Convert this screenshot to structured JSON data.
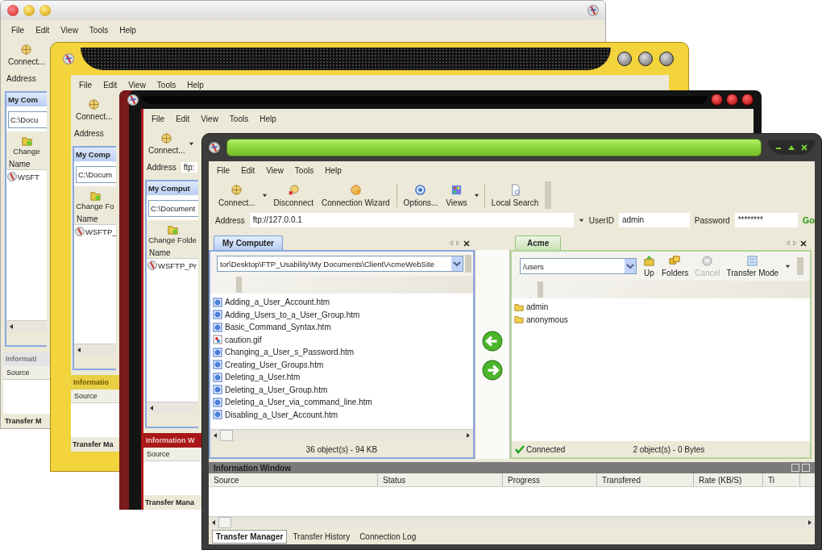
{
  "back_windows": [
    {
      "kind": "silver",
      "menu": [
        "File",
        "Edit",
        "View",
        "Tools",
        "Help"
      ],
      "toolbar_button": "Connect...",
      "toolbar_dropdown": false,
      "address_label": "Address",
      "pane_tab": "My Com",
      "path": "C:\\Docu",
      "change_folder": "Change",
      "column": "Name",
      "file": "WSFT",
      "info_title": "Informati",
      "info_column": "Source",
      "bottom_tab": "Transfer M"
    },
    {
      "kind": "yellow",
      "menu": [
        "File",
        "Edit",
        "View",
        "Tools",
        "Help"
      ],
      "toolbar_button": "Connect...",
      "toolbar_dropdown": false,
      "address_label": "Address",
      "pane_tab": "My Comp",
      "path": "C:\\Docum",
      "change_folder": "Change Fo",
      "column": "Name",
      "file": "WSFTP_",
      "info_title": "Informatio",
      "info_column": "Source",
      "bottom_tab": "Transfer Ma"
    },
    {
      "kind": "red",
      "menu": [
        "File",
        "Edit",
        "View",
        "Tools",
        "Help"
      ],
      "toolbar_button": "Connect...",
      "toolbar_dropdown": true,
      "address_label": "Address",
      "address_value": "ftp:",
      "pane_tab": "My Comput",
      "path": "C:\\Document",
      "change_folder": "Change Folde",
      "column": "Name",
      "file": "WSFTP_Pr",
      "info_title": "Information W",
      "info_column": "Source",
      "bottom_tab": "Transfer Mana"
    }
  ],
  "window": {
    "menu": [
      "File",
      "Edit",
      "View",
      "Tools",
      "Help"
    ],
    "toolbar": [
      {
        "label": "Connect...",
        "dropdown": true,
        "separator_after": false
      },
      {
        "label": "Disconnect",
        "dropdown": false,
        "separator_after": false
      },
      {
        "label": "Connection Wizard",
        "dropdown": false,
        "separator_after": true
      },
      {
        "label": "Options...",
        "dropdown": false,
        "separator_after": false
      },
      {
        "label": "Views",
        "dropdown": true,
        "separator_after": true
      },
      {
        "label": "Local Search",
        "dropdown": false,
        "separator_after": false
      }
    ],
    "address": {
      "label": "Address",
      "value": "ftp://127.0.0.1"
    },
    "user": {
      "label": "UserID",
      "value": "admin"
    },
    "password": {
      "label": "Password",
      "value": "********"
    },
    "go": "Go",
    "local_pane": {
      "tab": "My Computer",
      "path": "tor\\Desktop\\FTP_Usability\\My Documents\\Client\\AcmeWebSite",
      "files": [
        {
          "name": "Adding_a_User_Account.htm",
          "kind": "web"
        },
        {
          "name": "Adding_Users_to_a_User_Group.htm",
          "kind": "web"
        },
        {
          "name": "Basic_Command_Syntax.htm",
          "kind": "web"
        },
        {
          "name": "caution.gif",
          "kind": "image"
        },
        {
          "name": "Changing_a_User_s_Password.htm",
          "kind": "web"
        },
        {
          "name": "Creating_User_Groups.htm",
          "kind": "web"
        },
        {
          "name": "Deleting_a_User.htm",
          "kind": "web"
        },
        {
          "name": "Deleting_a_User_Group.htm",
          "kind": "web"
        },
        {
          "name": "Deleting_a_User_via_command_line.htm",
          "kind": "web"
        },
        {
          "name": "Disabling_a_User_Account.htm",
          "kind": "web"
        }
      ],
      "status": "36 object(s) - 94 KB"
    },
    "remote_pane": {
      "tab": "Acme",
      "path": "/users",
      "buttons": [
        {
          "label": "Up",
          "kind": "up",
          "disabled": false
        },
        {
          "label": "Folders",
          "kind": "folders",
          "disabled": false
        },
        {
          "label": "Cancel",
          "kind": "cancel",
          "disabled": true
        },
        {
          "label": "Transfer Mode",
          "kind": "mode",
          "disabled": false
        }
      ],
      "folders": [
        "admin",
        "anonymous"
      ],
      "connection": "Connected",
      "status": "2 object(s) - 0 Bytes"
    },
    "info": {
      "title": "Information Window",
      "columns": [
        "Source",
        "Status",
        "Progress",
        "Transfered",
        "Rate (KB/S)",
        "Ti"
      ],
      "tabs": [
        {
          "label": "Transfer Manager",
          "selected": true
        },
        {
          "label": "Transfer History",
          "selected": false
        },
        {
          "label": "Connection Log",
          "selected": false
        }
      ]
    }
  }
}
